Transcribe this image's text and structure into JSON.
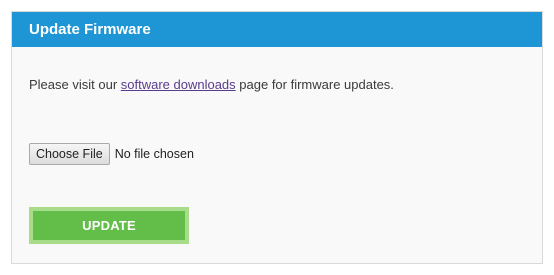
{
  "panel": {
    "title": "Update Firmware",
    "header_color": "#1e95d4"
  },
  "intro": {
    "prefix": "Please visit our ",
    "link_text": "software downloads",
    "suffix": " page for firmware updates."
  },
  "file_input": {
    "button_label": "Choose File",
    "status_text": "No file chosen"
  },
  "actions": {
    "update_label": "UPDATE",
    "update_color": "#62be48"
  }
}
